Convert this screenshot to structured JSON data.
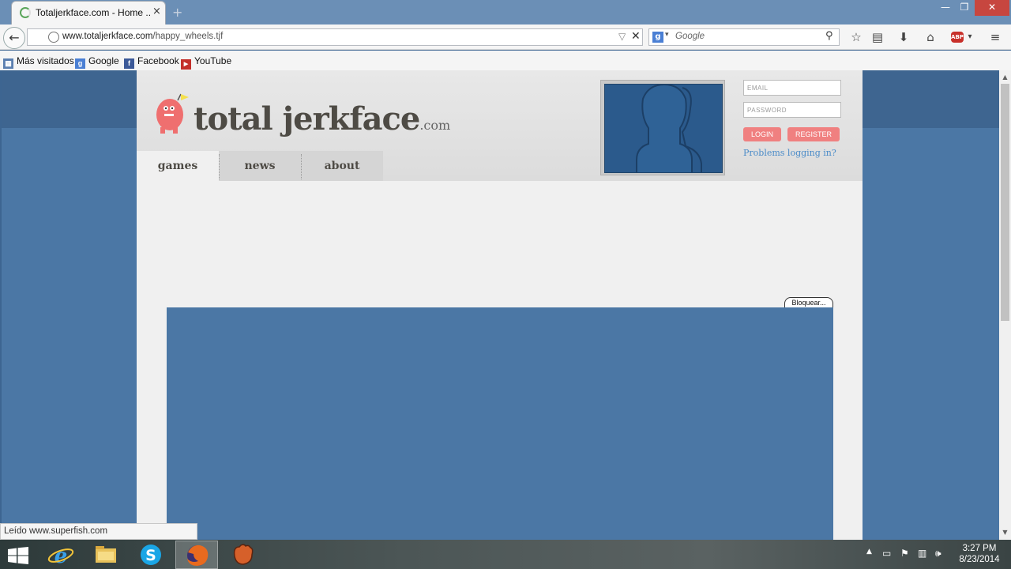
{
  "browser": {
    "tab": {
      "title": "Totaljerkface.com - Home ...",
      "close": "×"
    },
    "url": {
      "host": "www.totaljerkface.com",
      "path": "/happy_wheels.tjf"
    },
    "search": {
      "placeholder": "Google",
      "engine_letter": "g"
    },
    "abp_label": "ABP",
    "bookmarks": [
      {
        "label": "Más visitados",
        "icon": "most-visited-icon"
      },
      {
        "label": "Google",
        "icon": "google-icon"
      },
      {
        "label": "Facebook",
        "icon": "facebook-icon"
      },
      {
        "label": "YouTube",
        "icon": "youtube-icon"
      }
    ],
    "status": "Leído www.superfish.com"
  },
  "site": {
    "logo": {
      "name": "total jerkface",
      "suffix": ".com"
    },
    "nav": [
      "games",
      "news",
      "about"
    ],
    "active_nav": "games",
    "login": {
      "email_placeholder": "EMAIL",
      "password_placeholder": "PASSWORD",
      "login_label": "LOGIN",
      "register_label": "REGISTER",
      "problems_link": "Problems logging in?"
    },
    "block_tab": "Bloquear..."
  },
  "taskbar": {
    "apps": [
      "internet-explorer-icon",
      "file-explorer-icon",
      "skype-icon",
      "firefox-icon",
      "baseball-glove-icon"
    ],
    "active_app": "firefox-icon",
    "time": "3:27 PM",
    "date": "8/23/2014"
  },
  "colors": {
    "accent_red": "#f08080",
    "link_blue": "#4a8bc8",
    "page_bg_blue": "#4b77a5"
  }
}
